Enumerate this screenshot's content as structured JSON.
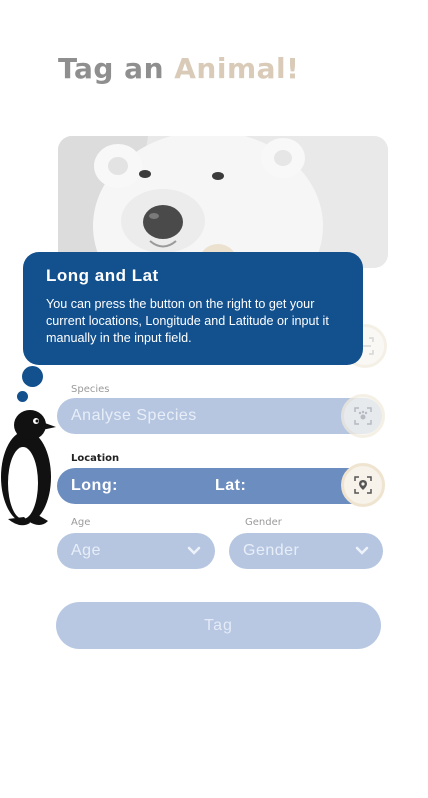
{
  "page": {
    "title_part1": "Tag an ",
    "title_part2": "Animal!"
  },
  "photo": {
    "subject": "polar-bear"
  },
  "tooltip": {
    "heading": "Long and Lat",
    "body": "You can press the button on the right to get your current locations, Longitude and Latitude or input it manually in the input field."
  },
  "species": {
    "label": "Species",
    "placeholder": "Analyse Species"
  },
  "location": {
    "label": "Location",
    "long": "Long:",
    "lat": "Lat:"
  },
  "age": {
    "label": "Age",
    "value": "Age"
  },
  "gender": {
    "label": "Gender",
    "value": "Gender"
  },
  "tag_button": {
    "label": "Tag"
  },
  "mascot": {
    "icon": "penguin"
  },
  "colors": {
    "tooltip_bg": "#12508e",
    "field_bg": "#b6c6e1",
    "field_active_bg": "#6c8dc0",
    "title_gray": "#8f8f8f",
    "title_accent": "#d9cbb8"
  }
}
